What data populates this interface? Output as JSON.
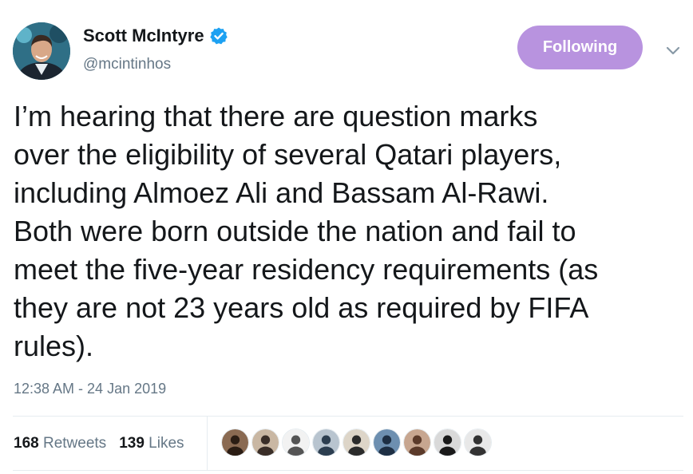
{
  "author": {
    "name": "Scott McIntyre",
    "handle": "@mcintinhos",
    "verified_icon": "verified-badge-icon",
    "verified_color": "#1da1f2"
  },
  "follow_button": {
    "label": "Following",
    "color": "#b893df"
  },
  "menu_icon": "chevron-down-icon",
  "tweet": {
    "lines": [
      "I’m hearing that there are question marks",
      "over the eligibility of several Qatari players,",
      "including Almoez Ali and Bassam Al-Rawi.",
      "Both were born outside the nation and fail to",
      "meet the five-year residency requirements (as",
      "they are not 23 years old as required by FIFA",
      "rules)."
    ],
    "timestamp": "12:38 AM - 24 Jan 2019"
  },
  "stats": {
    "retweets_count": "168",
    "retweets_label": "Retweets",
    "likes_count": "139",
    "likes_label": "Likes"
  },
  "likers": [
    {
      "name": "liker-avatar-1",
      "bg": "#8a6a52",
      "fg": "#2b1d14"
    },
    {
      "name": "liker-avatar-2",
      "bg": "#c9b7a3",
      "fg": "#3a2e28"
    },
    {
      "name": "liker-avatar-3",
      "bg": "#f2f2f2",
      "fg": "#555555"
    },
    {
      "name": "liker-avatar-4",
      "bg": "#b8c4cf",
      "fg": "#2c3e50"
    },
    {
      "name": "liker-avatar-5",
      "bg": "#ddd5c8",
      "fg": "#2b2b2b"
    },
    {
      "name": "liker-avatar-6",
      "bg": "#6d8fb0",
      "fg": "#1e2f44"
    },
    {
      "name": "liker-avatar-7",
      "bg": "#c7a690",
      "fg": "#5b3a2a"
    },
    {
      "name": "liker-avatar-8",
      "bg": "#d9d9d9",
      "fg": "#1a1a1a"
    },
    {
      "name": "liker-avatar-9",
      "bg": "#e8e8e8",
      "fg": "#333333"
    }
  ]
}
